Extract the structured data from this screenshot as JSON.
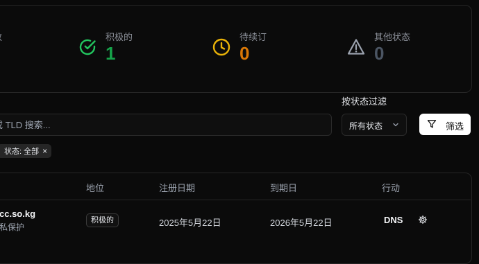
{
  "stats": [
    {
      "label": "数",
      "value": ""
    },
    {
      "label": "积极的",
      "value": "1",
      "color": "#16a34a"
    },
    {
      "label": "待续订",
      "value": "0",
      "color": "#d97706"
    },
    {
      "label": "其他状态",
      "value": "0",
      "color": "#4b5563"
    }
  ],
  "filters": {
    "status_filter_label": "按状态过滤",
    "search_placeholder": "或 TLD 搜索...",
    "status_select_value": "所有状态",
    "filter_button_label": "筛选",
    "active_chip": "状态: 全部",
    "chip_close": "×"
  },
  "table": {
    "headers": [
      "地位",
      "注册日期",
      "到期日",
      "行动"
    ],
    "rows": [
      {
        "domain": "cc.so.kg",
        "subtext": "私保护",
        "status": "积极的",
        "registered": "2025年5月22日",
        "expires": "2026年5月22日",
        "action_label": "DNS"
      }
    ]
  },
  "icons": {
    "active": "check-circle-icon",
    "renewal": "clock-icon",
    "other": "warning-triangle-icon",
    "filter": "funnel-icon",
    "select": "chevron-down-icon",
    "settings": "gear-icon"
  },
  "colors": {
    "background": "#0a0a0a",
    "active": "#16a34a",
    "pending": "#eab308",
    "other": "#9ca3af"
  }
}
